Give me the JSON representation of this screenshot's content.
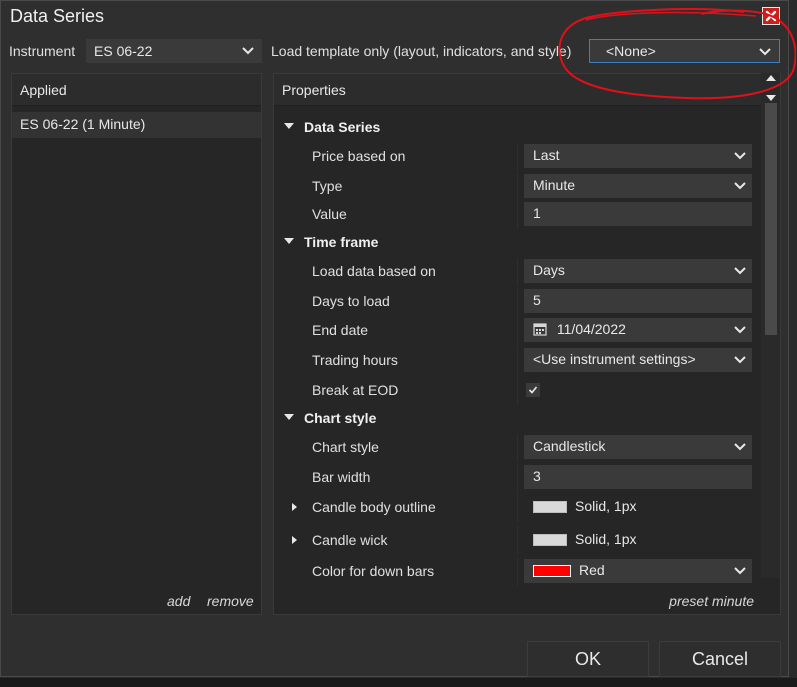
{
  "window": {
    "title": "Data Series"
  },
  "topbar": {
    "instrument_label": "Instrument",
    "instrument_value": "ES 06-22",
    "template_label": "Load template only (layout, indicators, and style)",
    "template_value": "<None>"
  },
  "applied": {
    "header": "Applied",
    "items": [
      "ES 06-22 (1 Minute)"
    ],
    "add_label": "add",
    "remove_label": "remove"
  },
  "properties": {
    "header": "Properties",
    "categories": {
      "data_series": {
        "label": "Data Series",
        "price_based_on": {
          "label": "Price based on",
          "value": "Last"
        },
        "type": {
          "label": "Type",
          "value": "Minute"
        },
        "value": {
          "label": "Value",
          "value": "1"
        }
      },
      "time_frame": {
        "label": "Time frame",
        "load_data_based_on": {
          "label": "Load data based on",
          "value": "Days"
        },
        "days_to_load": {
          "label": "Days to load",
          "value": "5"
        },
        "end_date": {
          "label": "End date",
          "value": "11/04/2022"
        },
        "trading_hours": {
          "label": "Trading hours",
          "value": "<Use instrument settings>"
        },
        "break_at_eod": {
          "label": "Break at EOD",
          "checked": true
        }
      },
      "chart_style": {
        "label": "Chart style",
        "chart_style": {
          "label": "Chart style",
          "value": "Candlestick"
        },
        "bar_width": {
          "label": "Bar width",
          "value": "3"
        },
        "candle_body_outline": {
          "label": "Candle body outline",
          "value": "Solid, 1px",
          "swatch": "#d9d9d9"
        },
        "candle_wick": {
          "label": "Candle wick",
          "value": "Solid, 1px",
          "swatch": "#d9d9d9"
        },
        "color_for_down_bars": {
          "label": "Color for down bars",
          "value": "Red",
          "swatch": "#ff0000"
        }
      }
    },
    "preset_label": "preset minute"
  },
  "buttons": {
    "ok": "OK",
    "cancel": "Cancel"
  },
  "colors": {
    "close_button": "#c8201c",
    "annotation": "#e0101a"
  }
}
